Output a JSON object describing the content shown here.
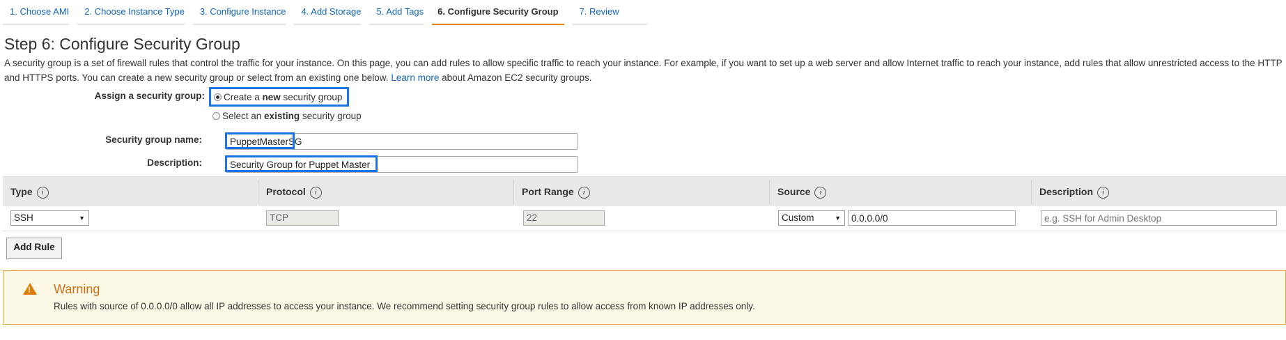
{
  "wizard": {
    "tabs": [
      {
        "label": "1. Choose AMI"
      },
      {
        "label": "2. Choose Instance Type"
      },
      {
        "label": "3. Configure Instance"
      },
      {
        "label": "4. Add Storage"
      },
      {
        "label": "5. Add Tags"
      },
      {
        "label": "6. Configure Security Group"
      },
      {
        "label": "7. Review"
      }
    ],
    "active_tab": "6. Configure Security Group"
  },
  "page": {
    "title": "Step 6: Configure Security Group",
    "intro_part1": "A security group is a set of firewall rules that control the traffic for your instance. On this page, you can add rules to allow specific traffic to reach your instance. For example, if you want to set up a web server and allow Internet traffic to reach your instance, add rules that allow unrestricted access to the HTTP and HTTPS ports. You can create a new security group or select from an existing one below.",
    "learn_more": "Learn more",
    "intro_part2": "about Amazon EC2 security groups."
  },
  "assign": {
    "label": "Assign a security group:",
    "option_new_pre": "Create a ",
    "option_new_bold": "new",
    "option_new_post": " security group",
    "option_existing_pre": "Select an ",
    "option_existing_bold": "existing",
    "option_existing_post": " security group",
    "selected": "new"
  },
  "form": {
    "name_label": "Security group name:",
    "name_value": "PuppetMasterSG",
    "description_label": "Description:",
    "description_value": "Security Group for Puppet Master"
  },
  "rules_table": {
    "headers": [
      "Type",
      "Protocol",
      "Port Range",
      "Source",
      "Description"
    ],
    "info_glyph": "i",
    "rows": [
      {
        "type": "SSH",
        "protocol": "TCP",
        "port_range": "22",
        "source_mode": "Custom",
        "source_cidr": "0.0.0.0/0",
        "description_placeholder": "e.g. SSH for Admin Desktop"
      }
    ]
  },
  "buttons": {
    "add_rule": "Add Rule"
  },
  "warning": {
    "title": "Warning",
    "text": "Rules with source of 0.0.0.0/0 allow all IP addresses to access your instance. We recommend setting security group rules to allow access from known IP addresses only."
  },
  "colors": {
    "link": "#1166bb",
    "active_tab_underline": "#e8820c",
    "highlight": "#1a73e8",
    "warning_title": "#c7711a",
    "warning_border": "#e8a33c",
    "warning_bg": "#fdf9e7"
  }
}
